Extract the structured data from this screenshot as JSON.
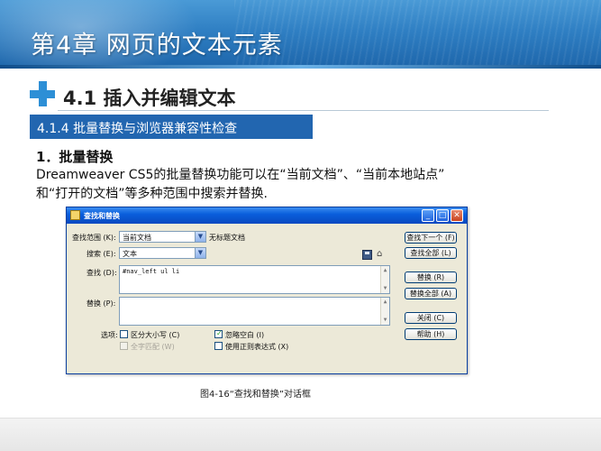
{
  "slide": {
    "chapter_title": "第4章  网页的文本元素",
    "section_heading": "4.1  插入并编辑文本",
    "subsection": "4.1.4  批量替换与浏览器兼容性检查",
    "body_title": "1．批量替换",
    "body_line1": "Dreamweaver CS5的批量替换功能可以在“当前文档”、“当前本地站点”",
    "body_line2": "和“打开的文档”等多种范围中搜索并替换.",
    "caption": "图4-16“查找和替换”对话框"
  },
  "dialog": {
    "title": "查找和替换",
    "scope_label": "查找范围 (K):",
    "scope_value": "当前文档",
    "doc_name": "无标题文档",
    "search_label": "搜索 (E):",
    "search_value": "文本",
    "find_label": "查找 (D):",
    "find_value": "#nav_left ul li",
    "replace_label": "替换 (P):",
    "replace_value": "",
    "options_label": "选项:",
    "options": {
      "match_case": "区分大小写 (C)",
      "match_case_checked": false,
      "ignore_whitespace": "忽略空白 (I)",
      "ignore_whitespace_checked": true,
      "whole_word": "全字匹配 (W)",
      "whole_word_checked": false,
      "whole_word_disabled": true,
      "regex": "使用正则表达式 (X)",
      "regex_checked": false
    },
    "buttons": {
      "find_next": "查找下一个 (F)",
      "find_all": "查找全部 (L)",
      "replace": "替换 (R)",
      "replace_all": "替换全部 (A)",
      "close": "关闭 (C)",
      "help": "帮助 (H)"
    },
    "window_controls": {
      "minimize": "_",
      "maximize": "□",
      "close": "✕"
    }
  }
}
